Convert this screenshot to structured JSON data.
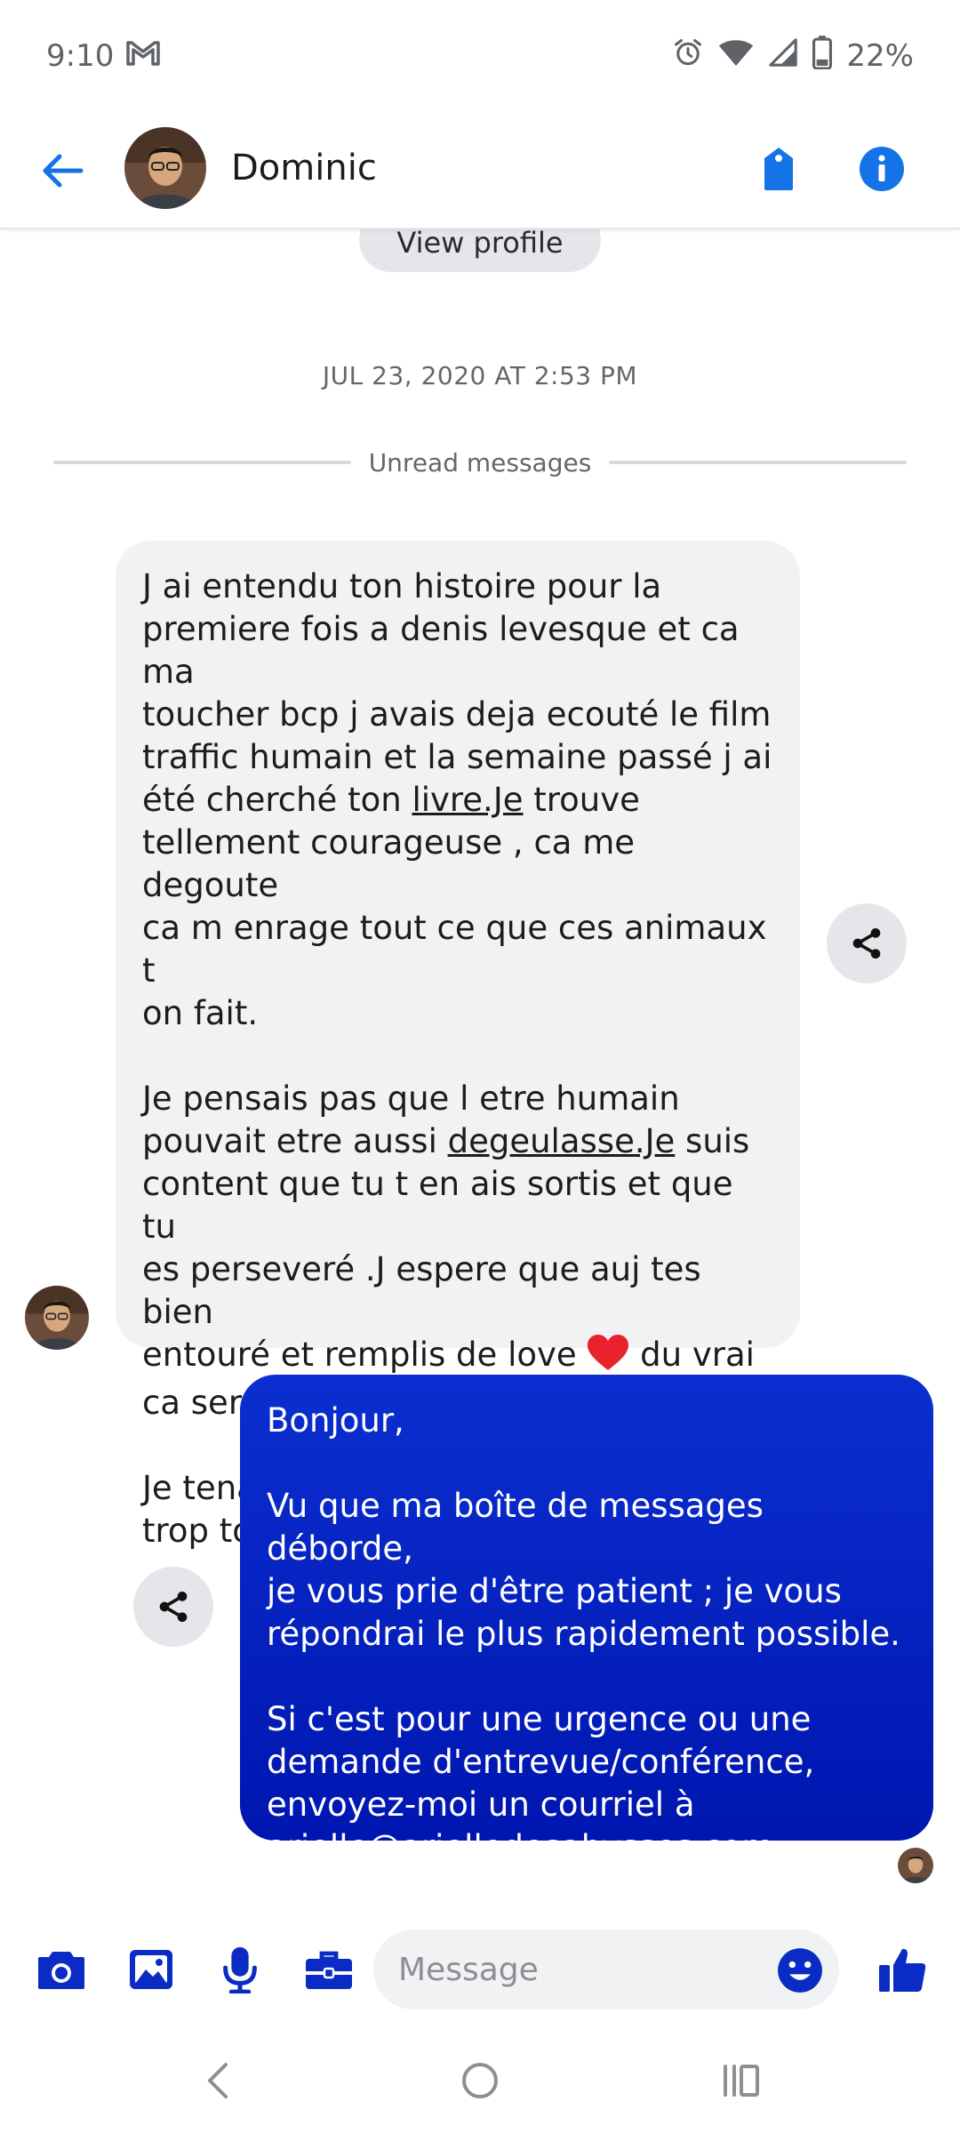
{
  "status_bar": {
    "time": "9:10",
    "battery": "22%",
    "icons": [
      "gmail-icon",
      "alarm-icon",
      "wifi-icon",
      "cell-signal-icon",
      "battery-icon"
    ]
  },
  "header": {
    "contact_name": "Dominic",
    "back_icon": "arrow-left-icon",
    "tag_icon": "tag-icon",
    "info_icon": "info-icon"
  },
  "conversation": {
    "view_profile_label": "View profile",
    "timestamp": "JUL 23, 2020 AT 2:53 PM",
    "unread_label": "Unread messages",
    "incoming_message": {
      "p1_before": "J ai entendu ton histoire pour la\npremiere fois a denis levesque et ca ma\ntoucher bcp j avais deja ecouté le film\ntraffic humain et la semaine passé j ai\nété cherché ton ",
      "p1_link": "livre.Je",
      "p1_after": " trouve\ntellement courageuse , ca me degoute\nca m enrage tout ce que ces animaux t\non fait.\n\nJe pensais pas que l etre humain\npouvait etre aussi ",
      "p2_link": "degeulasse.Je",
      "p2_after": " suis\ncontent que tu t en ais sortis et que tu\nes perseveré .J espere que auj tes bien\nentouré et remplis de love ",
      "p2_end": " du vrai\nca serait ton tour.\n\nJe tenais a t ecrire de quoi ca m avais\ntrop touché."
    },
    "outgoing_message": {
      "text": "Bonjour,\n\nVu que ma boîte de messages déborde,\nje vous prie d'être patient ; je vous\nrépondrai le plus rapidement possible.\n\nSi c'est pour une urgence ou une\ndemande d'entrevue/conférence,\nenvoyez-moi un courriel à\n",
      "email_link": "arielle@arielledesabysses.com",
      "end": "."
    }
  },
  "composer": {
    "placeholder": "Message",
    "icons": [
      "camera-icon",
      "image-icon",
      "microphone-icon",
      "toolbox-icon",
      "emoji-icon",
      "thumbs-up-icon"
    ]
  },
  "colors": {
    "accent": "#1473e6",
    "outgoing_bubble": "#0b2fd0",
    "incoming_bubble": "#f1f2f4",
    "composer_icon": "#0a2bc4"
  }
}
